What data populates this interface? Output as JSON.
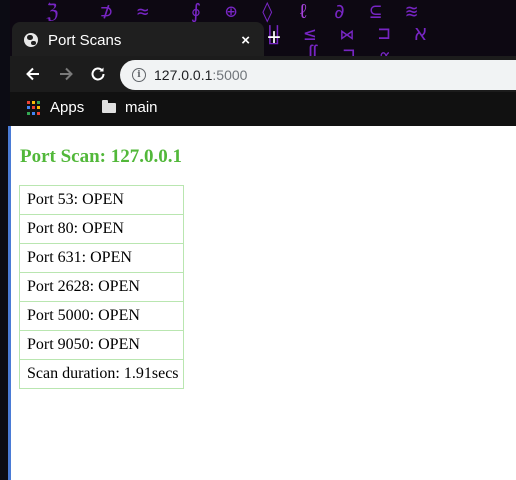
{
  "browser": {
    "tab": {
      "title": "Port Scans",
      "close_glyph": "×",
      "icon": "globe-icon"
    },
    "new_tab_glyph": "+",
    "nav": {
      "back_icon": "back-arrow-icon",
      "forward_icon": "forward-arrow-icon",
      "reload_icon": "reload-icon"
    },
    "address": {
      "host": "127.0.0.1",
      "port": ":5000",
      "info_icon": "info-icon"
    },
    "bookmarks": [
      {
        "label": "Apps",
        "icon": "apps-grid-icon"
      },
      {
        "label": "main",
        "icon": "folder-icon"
      }
    ],
    "background_color": "#8a2be2"
  },
  "page": {
    "title": "Port Scan: 127.0.0.1",
    "title_color": "#52b83a",
    "border_color": "#b9e6b0",
    "rows": [
      "Port 53: OPEN",
      "Port 80: OPEN",
      "Port 631: OPEN",
      "Port 2628: OPEN",
      "Port 5000: OPEN",
      "Port 9050: OPEN",
      "Scan duration: 1.91secs"
    ]
  }
}
